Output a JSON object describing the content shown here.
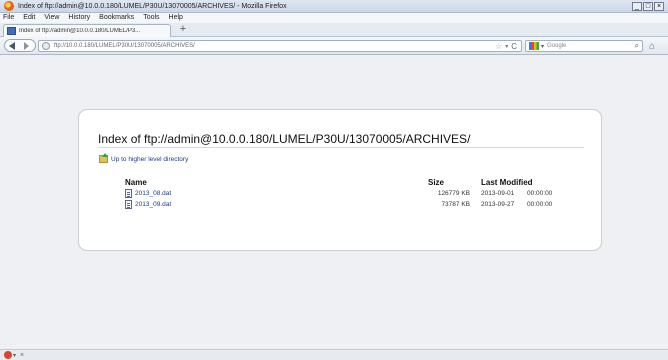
{
  "window": {
    "title": "Index of ftp://admin@10.0.0.180/LUMEL/P30U/13070005/ARCHIVES/ - Mozilla Firefox",
    "buttons": {
      "minimize": "_",
      "maximize": "□",
      "close": "×"
    }
  },
  "menu": [
    "File",
    "Edit",
    "View",
    "History",
    "Bookmarks",
    "Tools",
    "Help"
  ],
  "tab": {
    "label": "Index of ftp://admin@10.0.0.180/LUMEL/P3...",
    "new_tab": "+"
  },
  "nav": {
    "url": "ftp://10.0.0.180/LUMEL/P30U/13070005/ARCHIVES/",
    "star": "☆",
    "dropmarker": "▾",
    "reload": "C",
    "search_placeholder": "Google",
    "search_engine_drop": "▾",
    "search_go": "⌕",
    "home": "⌂"
  },
  "listing": {
    "title": "Index of ftp://admin@10.0.0.180/LUMEL/P30U/13070005/ARCHIVES/",
    "up_link": "Up to higher level directory",
    "headers": {
      "name": "Name",
      "size": "Size",
      "modified": "Last Modified"
    },
    "files": [
      {
        "name": "2013_08.dat",
        "size": "126779 KB",
        "date": "2013-09-01",
        "time": "00:00:00"
      },
      {
        "name": "2013_09.dat",
        "size": "73787 KB",
        "date": "2013-09-27",
        "time": "00:00:00"
      }
    ]
  },
  "statusbar": {
    "addon_drop": "▾",
    "close": "×"
  }
}
